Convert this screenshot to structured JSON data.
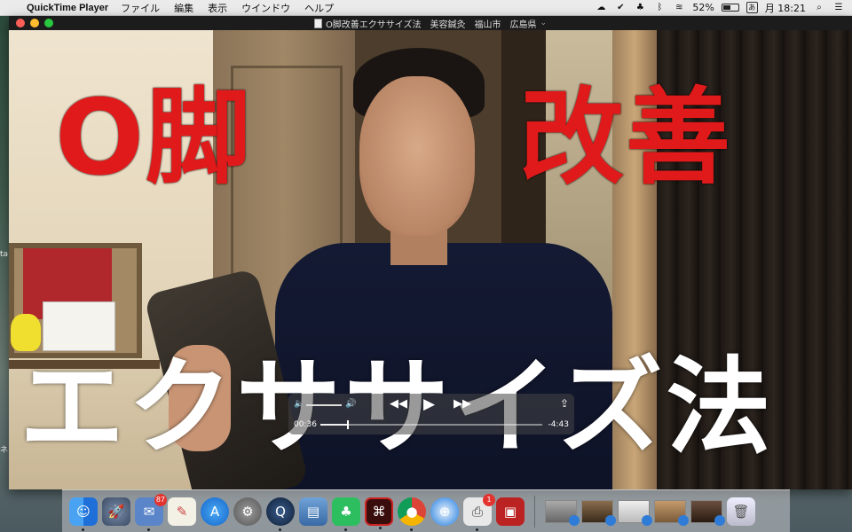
{
  "menubar": {
    "app_name": "QuickTime Player",
    "menus": [
      "ファイル",
      "編集",
      "表示",
      "ウインドウ",
      "ヘルプ"
    ],
    "battery_percent": "52%",
    "battery_level": 0.52,
    "ime": "あ",
    "clock": "月 18:21"
  },
  "window": {
    "title": "O脚改善エクササイズ法　美容鍼灸　福山市　広島県"
  },
  "video": {
    "caption_left": "O脚",
    "caption_right": "改善",
    "caption_bottom": "エクササイズ法"
  },
  "controls": {
    "current_time": "00:36",
    "end_time": "-4:43",
    "progress": 0.12
  },
  "dock": {
    "mail_badge": "87",
    "print_badge": "1"
  },
  "colors": {
    "caption_red": "#e01a1a",
    "caption_white": "#ffffff"
  }
}
